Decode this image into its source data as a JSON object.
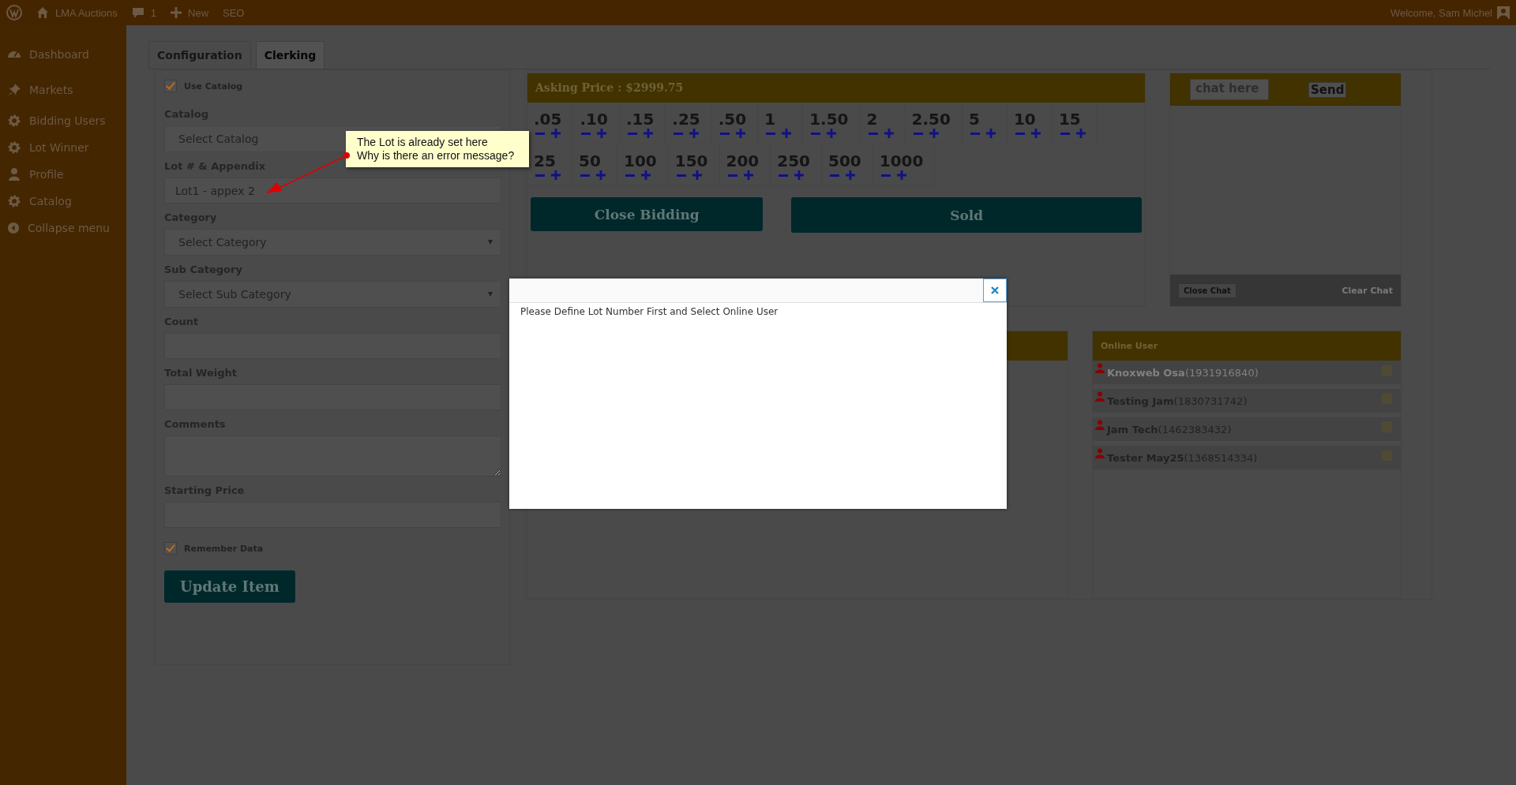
{
  "top_bar": {
    "site": "LMA Auctions",
    "comments": "1",
    "new": "New",
    "seo": "SEO",
    "welcome": "Welcome, Sam Michel"
  },
  "sidebar": {
    "items": [
      {
        "label": "Dashboard"
      },
      {
        "label": "Markets"
      },
      {
        "label": "Bidding Users"
      },
      {
        "label": "Lot Winner"
      },
      {
        "label": "Profile"
      },
      {
        "label": "Catalog"
      },
      {
        "label": "Collapse menu"
      }
    ]
  },
  "tabs": [
    {
      "label": "Configuration",
      "selected": false
    },
    {
      "label": "Clerking",
      "selected": true
    }
  ],
  "form": {
    "fields": [
      {
        "kind": "checkbox",
        "label": "Use Catalog",
        "checked": true
      },
      {
        "kind": "select",
        "label": "Catalog",
        "placeholder": "Select Catalog"
      },
      {
        "kind": "text",
        "label": "Lot # & Appendix",
        "value": "Lot1 - appex 2"
      },
      {
        "kind": "select",
        "label": "Category",
        "placeholder": "Select Category"
      },
      {
        "kind": "select",
        "label": "Sub Category",
        "placeholder": "Select Sub Category"
      },
      {
        "kind": "text",
        "label": "Count"
      },
      {
        "kind": "text",
        "label": "Total Weight"
      },
      {
        "kind": "textarea",
        "label": "Comments"
      },
      {
        "kind": "text",
        "label": "Starting Price"
      },
      {
        "kind": "checkbox",
        "label": "Remember Data",
        "checked": true
      }
    ],
    "submit": "Update Item"
  },
  "bidding": {
    "asking_price": "Asking Price : $2999.75",
    "step_rows": [
      [
        {
          "amount": ".05"
        },
        {
          "amount": ".10"
        },
        {
          "amount": ".15"
        },
        {
          "amount": ".25"
        },
        {
          "amount": ".50"
        },
        {
          "amount": "1"
        },
        {
          "amount": "1.50"
        },
        {
          "amount": "2"
        },
        {
          "amount": "2.50"
        },
        {
          "amount": "5"
        },
        {
          "amount": "10"
        },
        {
          "amount": "15"
        }
      ],
      [
        {
          "amount": "25"
        },
        {
          "amount": "50"
        },
        {
          "amount": "100"
        },
        {
          "amount": "150"
        },
        {
          "amount": "200"
        },
        {
          "amount": "250"
        },
        {
          "amount": "500"
        },
        {
          "amount": "1000"
        }
      ]
    ],
    "buttons": [
      "Close Bidding",
      "Sold"
    ]
  },
  "chat": {
    "placeholder": "chat here",
    "send": "Send",
    "close": "Close Chat",
    "clear": "Clear Chat"
  },
  "online_users": {
    "title": "Online User",
    "users": [
      {
        "name": "Knoxweb Osa",
        "id": "(1931916840)",
        "dimmed": true,
        "checked": false
      },
      {
        "name": "Testing Jam",
        "id": "(1830731742)",
        "dimmed": false,
        "checked": false
      },
      {
        "name": "Jam Tech",
        "id": "(1462383432)",
        "dimmed": false,
        "checked": false
      },
      {
        "name": "Tester May25",
        "id": "(1368514334)",
        "dimmed": false,
        "checked": false
      }
    ]
  },
  "dialog": {
    "message": "Please Define Lot Number First and Select Online User"
  },
  "annotation": {
    "text": "The Lot is already set here\nWhy is there an error message?"
  }
}
